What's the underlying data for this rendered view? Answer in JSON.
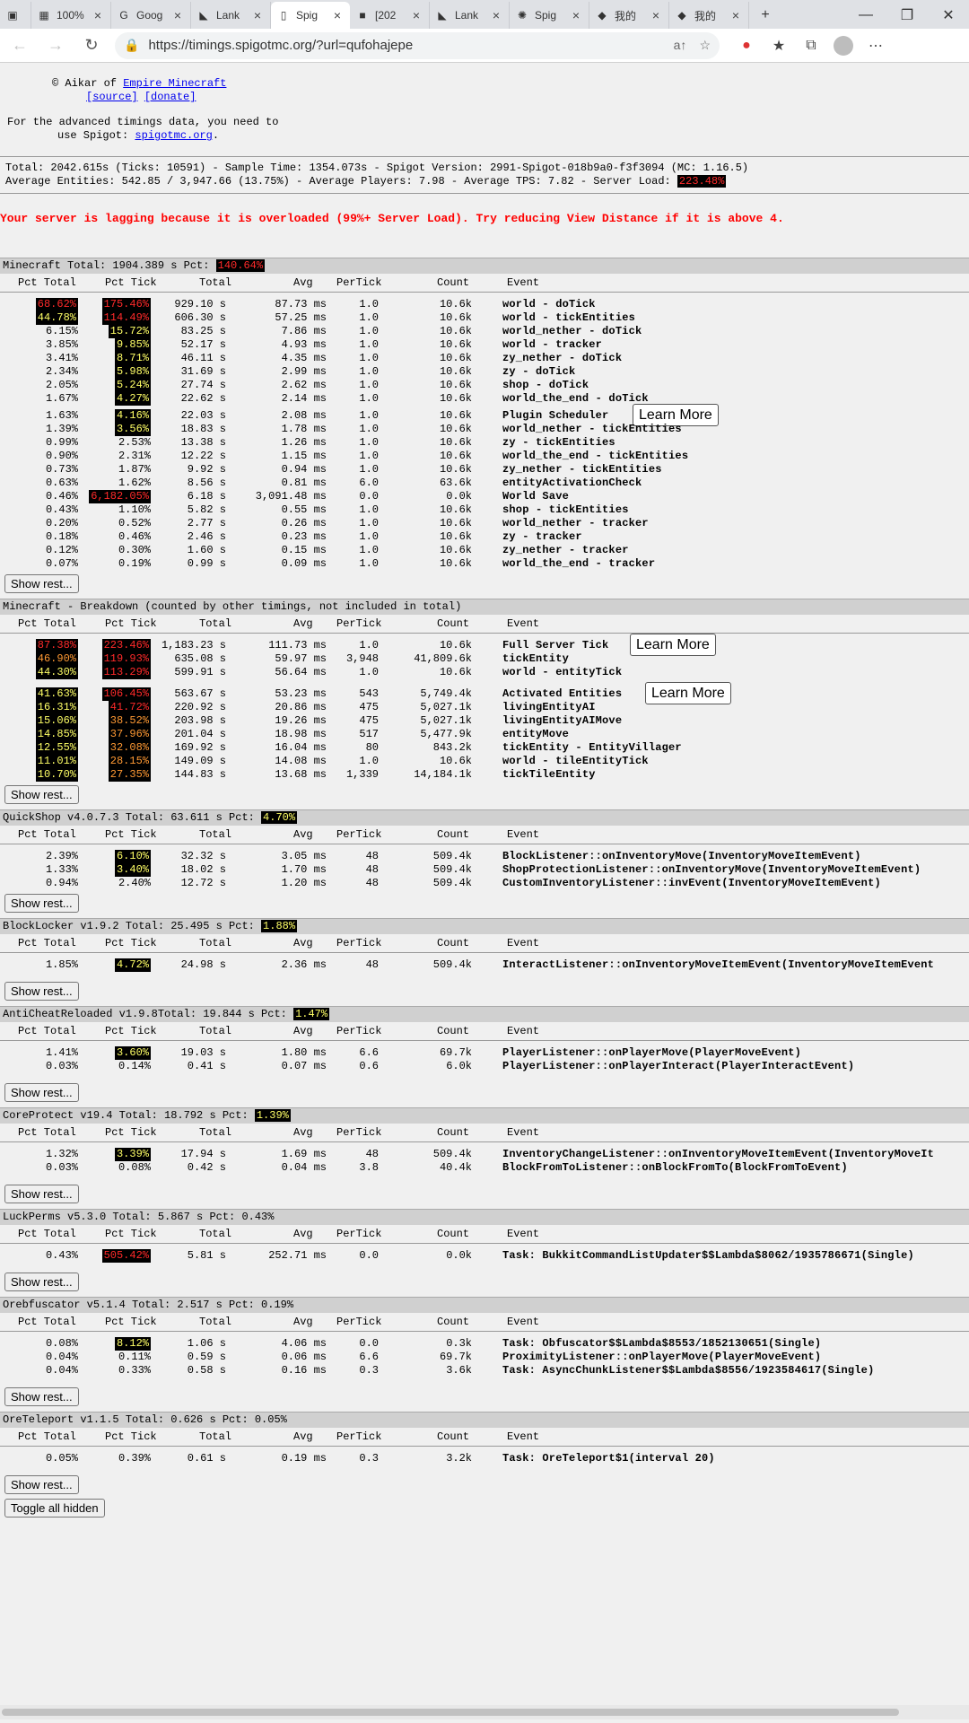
{
  "browser": {
    "tabs": [
      {
        "title": "",
        "icon": "tab-actions-icon"
      },
      {
        "title": "100%",
        "icon": "image-icon"
      },
      {
        "title": "Goog",
        "icon": "translate-icon"
      },
      {
        "title": "Lank",
        "icon": "lank-icon"
      },
      {
        "title": "Spig",
        "icon": "page-icon",
        "active": true
      },
      {
        "title": "[202",
        "icon": "box-icon"
      },
      {
        "title": "Lank",
        "icon": "lank-icon"
      },
      {
        "title": "Spig",
        "icon": "spigot-icon"
      },
      {
        "title": "我的",
        "icon": "brand-icon"
      },
      {
        "title": "我的",
        "icon": "brand-icon"
      }
    ],
    "url": "https://timings.spigotmc.org/?url=qufohajepe"
  },
  "credit": {
    "by": "© Aikar of ",
    "site": "Empire Minecraft",
    "source": "[source]",
    "donate": "[donate]"
  },
  "note": {
    "line1": "For the advanced timings data, you need to",
    "line2_pre": "use Spigot: ",
    "link": "spigotmc.org",
    "line2_post": "."
  },
  "summary": {
    "line1": "Total: 2042.615s (Ticks: 10591) - Sample Time: 1354.073s  - Spigot Version: 2991-Spigot-018b9a0-f3f3094 (MC: 1.16.5)",
    "line2_pre": "Average Entities: 542.85 / 3,947.66 (13.75%) - Average Players: 7.98 - Average TPS: 7.82 - Server Load: ",
    "load": "223.48%"
  },
  "lag_warning": "Your server is lagging because it is overloaded (99%+ Server Load). Try reducing View Distance if it is above 4.",
  "columns": [
    "Pct Total",
    "Pct Tick",
    "Total",
    "Avg",
    "PerTick",
    "Count",
    "Event"
  ],
  "labels": {
    "show_rest": "Show rest...",
    "learn_more": "Learn More",
    "toggle_all": "Toggle all hidden"
  },
  "sections": [
    {
      "title": "Minecraft Total: 1904.389 s Pct: ",
      "pct": "140.64%",
      "rows": [
        [
          "68.62%",
          "175.46%",
          "929.10 s",
          "87.73 ms",
          "1.0",
          "10.6k",
          "world - doTick"
        ],
        [
          "44.78%",
          "114.49%",
          "606.30 s",
          "57.25 ms",
          "1.0",
          "10.6k",
          "world - tickEntities"
        ],
        [
          "6.15%",
          "15.72%",
          "83.25 s",
          "7.86 ms",
          "1.0",
          "10.6k",
          "world_nether - doTick"
        ],
        [
          "3.85%",
          "9.85%",
          "52.17 s",
          "4.93 ms",
          "1.0",
          "10.6k",
          "world - tracker"
        ],
        [
          "3.41%",
          "8.71%",
          "46.11 s",
          "4.35 ms",
          "1.0",
          "10.6k",
          "zy_nether - doTick"
        ],
        [
          "2.34%",
          "5.98%",
          "31.69 s",
          "2.99 ms",
          "1.0",
          "10.6k",
          "zy - doTick"
        ],
        [
          "2.05%",
          "5.24%",
          "27.74 s",
          "2.62 ms",
          "1.0",
          "10.6k",
          "shop - doTick"
        ],
        [
          "1.67%",
          "4.27%",
          "22.62 s",
          "2.14 ms",
          "1.0",
          "10.6k",
          "world_the_end - doTick"
        ],
        [
          "1.63%",
          "4.16%",
          "22.03 s",
          "2.08 ms",
          "1.0",
          "10.6k",
          "Plugin Scheduler"
        ],
        [
          "1.39%",
          "3.56%",
          "18.83 s",
          "1.78 ms",
          "1.0",
          "10.6k",
          "world_nether - tickEntities"
        ],
        [
          "0.99%",
          "2.53%",
          "13.38 s",
          "1.26 ms",
          "1.0",
          "10.6k",
          "zy - tickEntities"
        ],
        [
          "0.90%",
          "2.31%",
          "12.22 s",
          "1.15 ms",
          "1.0",
          "10.6k",
          "world_the_end - tickEntities"
        ],
        [
          "0.73%",
          "1.87%",
          "9.92 s",
          "0.94 ms",
          "1.0",
          "10.6k",
          "zy_nether - tickEntities"
        ],
        [
          "0.63%",
          "1.62%",
          "8.56 s",
          "0.81 ms",
          "6.0",
          "63.6k",
          "entityActivationCheck"
        ],
        [
          "0.46%",
          "6,182.05%",
          "6.18 s",
          "3,091.48 ms",
          "0.0",
          "0.0k",
          "World Save"
        ],
        [
          "0.43%",
          "1.10%",
          "5.82 s",
          "0.55 ms",
          "1.0",
          "10.6k",
          "shop - tickEntities"
        ],
        [
          "0.20%",
          "0.52%",
          "2.77 s",
          "0.26 ms",
          "1.0",
          "10.6k",
          "world_nether - tracker"
        ],
        [
          "0.18%",
          "0.46%",
          "2.46 s",
          "0.23 ms",
          "1.0",
          "10.6k",
          "zy - tracker"
        ],
        [
          "0.12%",
          "0.30%",
          "1.60 s",
          "0.15 ms",
          "1.0",
          "10.6k",
          "zy_nether - tracker"
        ],
        [
          "0.07%",
          "0.19%",
          "0.99 s",
          "0.09 ms",
          "1.0",
          "10.6k",
          "world_the_end - tracker"
        ]
      ]
    },
    {
      "title": "Minecraft - Breakdown (counted by other timings, not included in total)",
      "pct": "",
      "rows": [
        [
          "87.38%",
          "223.46%",
          "1,183.23 s",
          "111.73 ms",
          "1.0",
          "10.6k",
          "Full Server Tick"
        ],
        [
          "46.90%",
          "119.93%",
          "635.08 s",
          "59.97 ms",
          "3,948",
          "41,809.6k",
          "tickEntity"
        ],
        [
          "44.30%",
          "113.29%",
          "599.91 s",
          "56.64 ms",
          "1.0",
          "10.6k",
          "world - entityTick"
        ],
        [
          "41.63%",
          "106.45%",
          "563.67 s",
          "53.23 ms",
          "543",
          "5,749.4k",
          "Activated Entities"
        ],
        [
          "16.31%",
          "41.72%",
          "220.92 s",
          "20.86 ms",
          "475",
          "5,027.1k",
          "livingEntityAI"
        ],
        [
          "15.06%",
          "38.52%",
          "203.98 s",
          "19.26 ms",
          "475",
          "5,027.1k",
          "livingEntityAIMove"
        ],
        [
          "14.85%",
          "37.96%",
          "201.04 s",
          "18.98 ms",
          "517",
          "5,477.9k",
          "entityMove"
        ],
        [
          "12.55%",
          "32.08%",
          "169.92 s",
          "16.04 ms",
          "80",
          "843.2k",
          "tickEntity - EntityVillager"
        ],
        [
          "11.01%",
          "28.15%",
          "149.09 s",
          "14.08 ms",
          "1.0",
          "10.6k",
          "world - tileEntityTick"
        ],
        [
          "10.70%",
          "27.35%",
          "144.83 s",
          "13.68 ms",
          "1,339",
          "14,184.1k",
          "tickTileEntity"
        ]
      ]
    },
    {
      "title": "QuickShop v4.0.7.3 Total: 63.611 s Pct: ",
      "pct": "4.70%",
      "rows": [
        [
          "2.39%",
          "6.10%",
          "32.32 s",
          "3.05 ms",
          "48",
          "509.4k",
          "BlockListener::onInventoryMove(InventoryMoveItemEvent)"
        ],
        [
          "1.33%",
          "3.40%",
          "18.02 s",
          "1.70 ms",
          "48",
          "509.4k",
          "ShopProtectionListener::onInventoryMove(InventoryMoveItemEvent)"
        ],
        [
          "0.94%",
          "2.40%",
          "12.72 s",
          "1.20 ms",
          "48",
          "509.4k",
          "CustomInventoryListener::invEvent(InventoryMoveItemEvent)"
        ]
      ]
    },
    {
      "title": "BlockLocker v1.9.2 Total: 25.495 s Pct: ",
      "pct": "1.88%",
      "rows": [
        [
          "1.85%",
          "4.72%",
          "24.98 s",
          "2.36 ms",
          "48",
          "509.4k",
          "InteractListener::onInventoryMoveItemEvent(InventoryMoveItemEvent"
        ]
      ]
    },
    {
      "title": "AntiCheatReloaded v1.9.8Total: 19.844 s Pct: ",
      "pct": "1.47%",
      "rows": [
        [
          "1.41%",
          "3.60%",
          "19.03 s",
          "1.80 ms",
          "6.6",
          "69.7k",
          "PlayerListener::onPlayerMove(PlayerMoveEvent)"
        ],
        [
          "0.03%",
          "0.14%",
          "0.41 s",
          "0.07 ms",
          "0.6",
          "6.0k",
          "PlayerListener::onPlayerInteract(PlayerInteractEvent)"
        ]
      ]
    },
    {
      "title": "CoreProtect v19.4 Total: 18.792 s Pct: ",
      "pct": "1.39%",
      "rows": [
        [
          "1.32%",
          "3.39%",
          "17.94 s",
          "1.69 ms",
          "48",
          "509.4k",
          "InventoryChangeListener::onInventoryMoveItemEvent(InventoryMoveIt"
        ],
        [
          "0.03%",
          "0.08%",
          "0.42 s",
          "0.04 ms",
          "3.8",
          "40.4k",
          "BlockFromToListener::onBlockFromTo(BlockFromToEvent)"
        ]
      ]
    },
    {
      "title": "LuckPerms v5.3.0 Total: 5.867 s Pct: 0.43%",
      "pct": "",
      "rows": [
        [
          "0.43%",
          "505.42%",
          "5.81 s",
          "252.71 ms",
          "0.0",
          "0.0k",
          "Task: BukkitCommandListUpdater$$Lambda$8062/1935786671(Single)"
        ]
      ]
    },
    {
      "title": "Orebfuscator v5.1.4 Total: 2.517 s Pct: 0.19%",
      "pct": "",
      "rows": [
        [
          "0.08%",
          "8.12%",
          "1.06 s",
          "4.06 ms",
          "0.0",
          "0.3k",
          "Task: Obfuscator$$Lambda$8553/1852130651(Single)"
        ],
        [
          "0.04%",
          "0.11%",
          "0.59 s",
          "0.06 ms",
          "6.6",
          "69.7k",
          "ProximityListener::onPlayerMove(PlayerMoveEvent)"
        ],
        [
          "0.04%",
          "0.33%",
          "0.58 s",
          "0.16 ms",
          "0.3",
          "3.6k",
          "Task: AsyncChunkListener$$Lambda$8556/1923584617(Single)"
        ]
      ]
    },
    {
      "title": "OreTeleport v1.1.5 Total: 0.626 s Pct: 0.05%",
      "pct": "",
      "rows": [
        [
          "0.05%",
          "0.39%",
          "0.61 s",
          "0.19 ms",
          "0.3",
          "3.2k",
          "Task: OreTeleport$1(interval 20)"
        ]
      ]
    }
  ]
}
